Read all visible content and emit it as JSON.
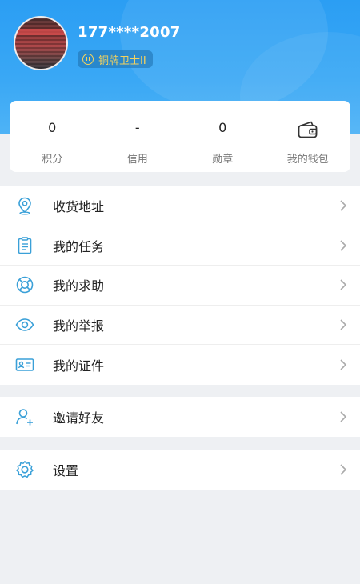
{
  "profile": {
    "phone": "177****2007",
    "badge": "铜牌卫士II"
  },
  "stats": [
    {
      "value": "0",
      "label": "积分"
    },
    {
      "value": "-",
      "label": "信用"
    },
    {
      "value": "0",
      "label": "勋章"
    },
    {
      "icon": "wallet-icon",
      "label": "我的钱包"
    }
  ],
  "menu": {
    "address": "收货地址",
    "tasks": "我的任务",
    "help": "我的求助",
    "reports": "我的举报",
    "certificates": "我的证件",
    "invite": "邀请好友",
    "settings": "设置"
  },
  "colors": {
    "header": "#2b9ef3",
    "accent_icon": "#3aa0d8",
    "badge_text": "#f4d35e"
  }
}
